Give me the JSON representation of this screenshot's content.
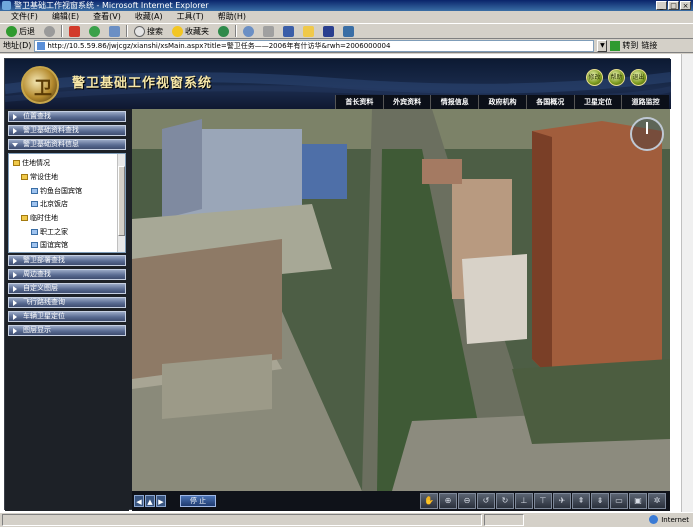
{
  "window": {
    "title": "警卫基础工作视窗系统 - Microsoft Internet Explorer",
    "controls": [
      "_",
      "□",
      "×"
    ]
  },
  "menu": [
    "文件(F)",
    "编辑(E)",
    "查看(V)",
    "收藏(A)",
    "工具(T)",
    "帮助(H)"
  ],
  "toolbar": {
    "back": "后退",
    "search": "搜索",
    "favorites": "收藏夹"
  },
  "address": {
    "label": "地址(D)",
    "url": "http://10.5.59.86/jwjcgz/xianshi/xsMain.aspx?title=警卫任务——2006年有什访华&rwh=2006000004",
    "go": "转到",
    "links": "链接"
  },
  "app": {
    "title": "警卫基础工作视窗系统",
    "logo_char": "卫",
    "header_buttons": [
      "修改",
      "帮助",
      "退出"
    ],
    "topnav": [
      "首长资料",
      "外宾资料",
      "情报信息",
      "政府机构",
      "各国概况",
      "卫星定位",
      "道路监控"
    ]
  },
  "sidebar": {
    "top_items": [
      "位置查找",
      "警卫基础资料查找",
      "警卫基础资料信息"
    ],
    "tree": [
      {
        "label": "住地情况",
        "level": 0
      },
      {
        "label": "常设住地",
        "level": 1
      },
      {
        "label": "钓鱼台国宾馆",
        "level": 2
      },
      {
        "label": "北京饭店",
        "level": 2
      },
      {
        "label": "临时住地",
        "level": 1
      },
      {
        "label": "职工之家",
        "level": 2
      },
      {
        "label": "国谊宾馆",
        "level": 2
      }
    ],
    "bottom_items": [
      "警卫部署查找",
      "周边查找",
      "自定义图层",
      "飞行路线查询",
      "车辆卫星定位",
      "图层显示"
    ]
  },
  "map": {
    "stop_label": "停 止",
    "nav_labels": [
      "◀",
      "▲",
      "▶"
    ],
    "tool_icons": [
      "✋",
      "⊕",
      "⊖",
      "↺",
      "↻",
      "⊥",
      "⊤",
      "✈",
      "⇞",
      "⇟",
      "▭",
      "▣",
      "✲"
    ]
  },
  "status": {
    "zone": "Internet"
  }
}
